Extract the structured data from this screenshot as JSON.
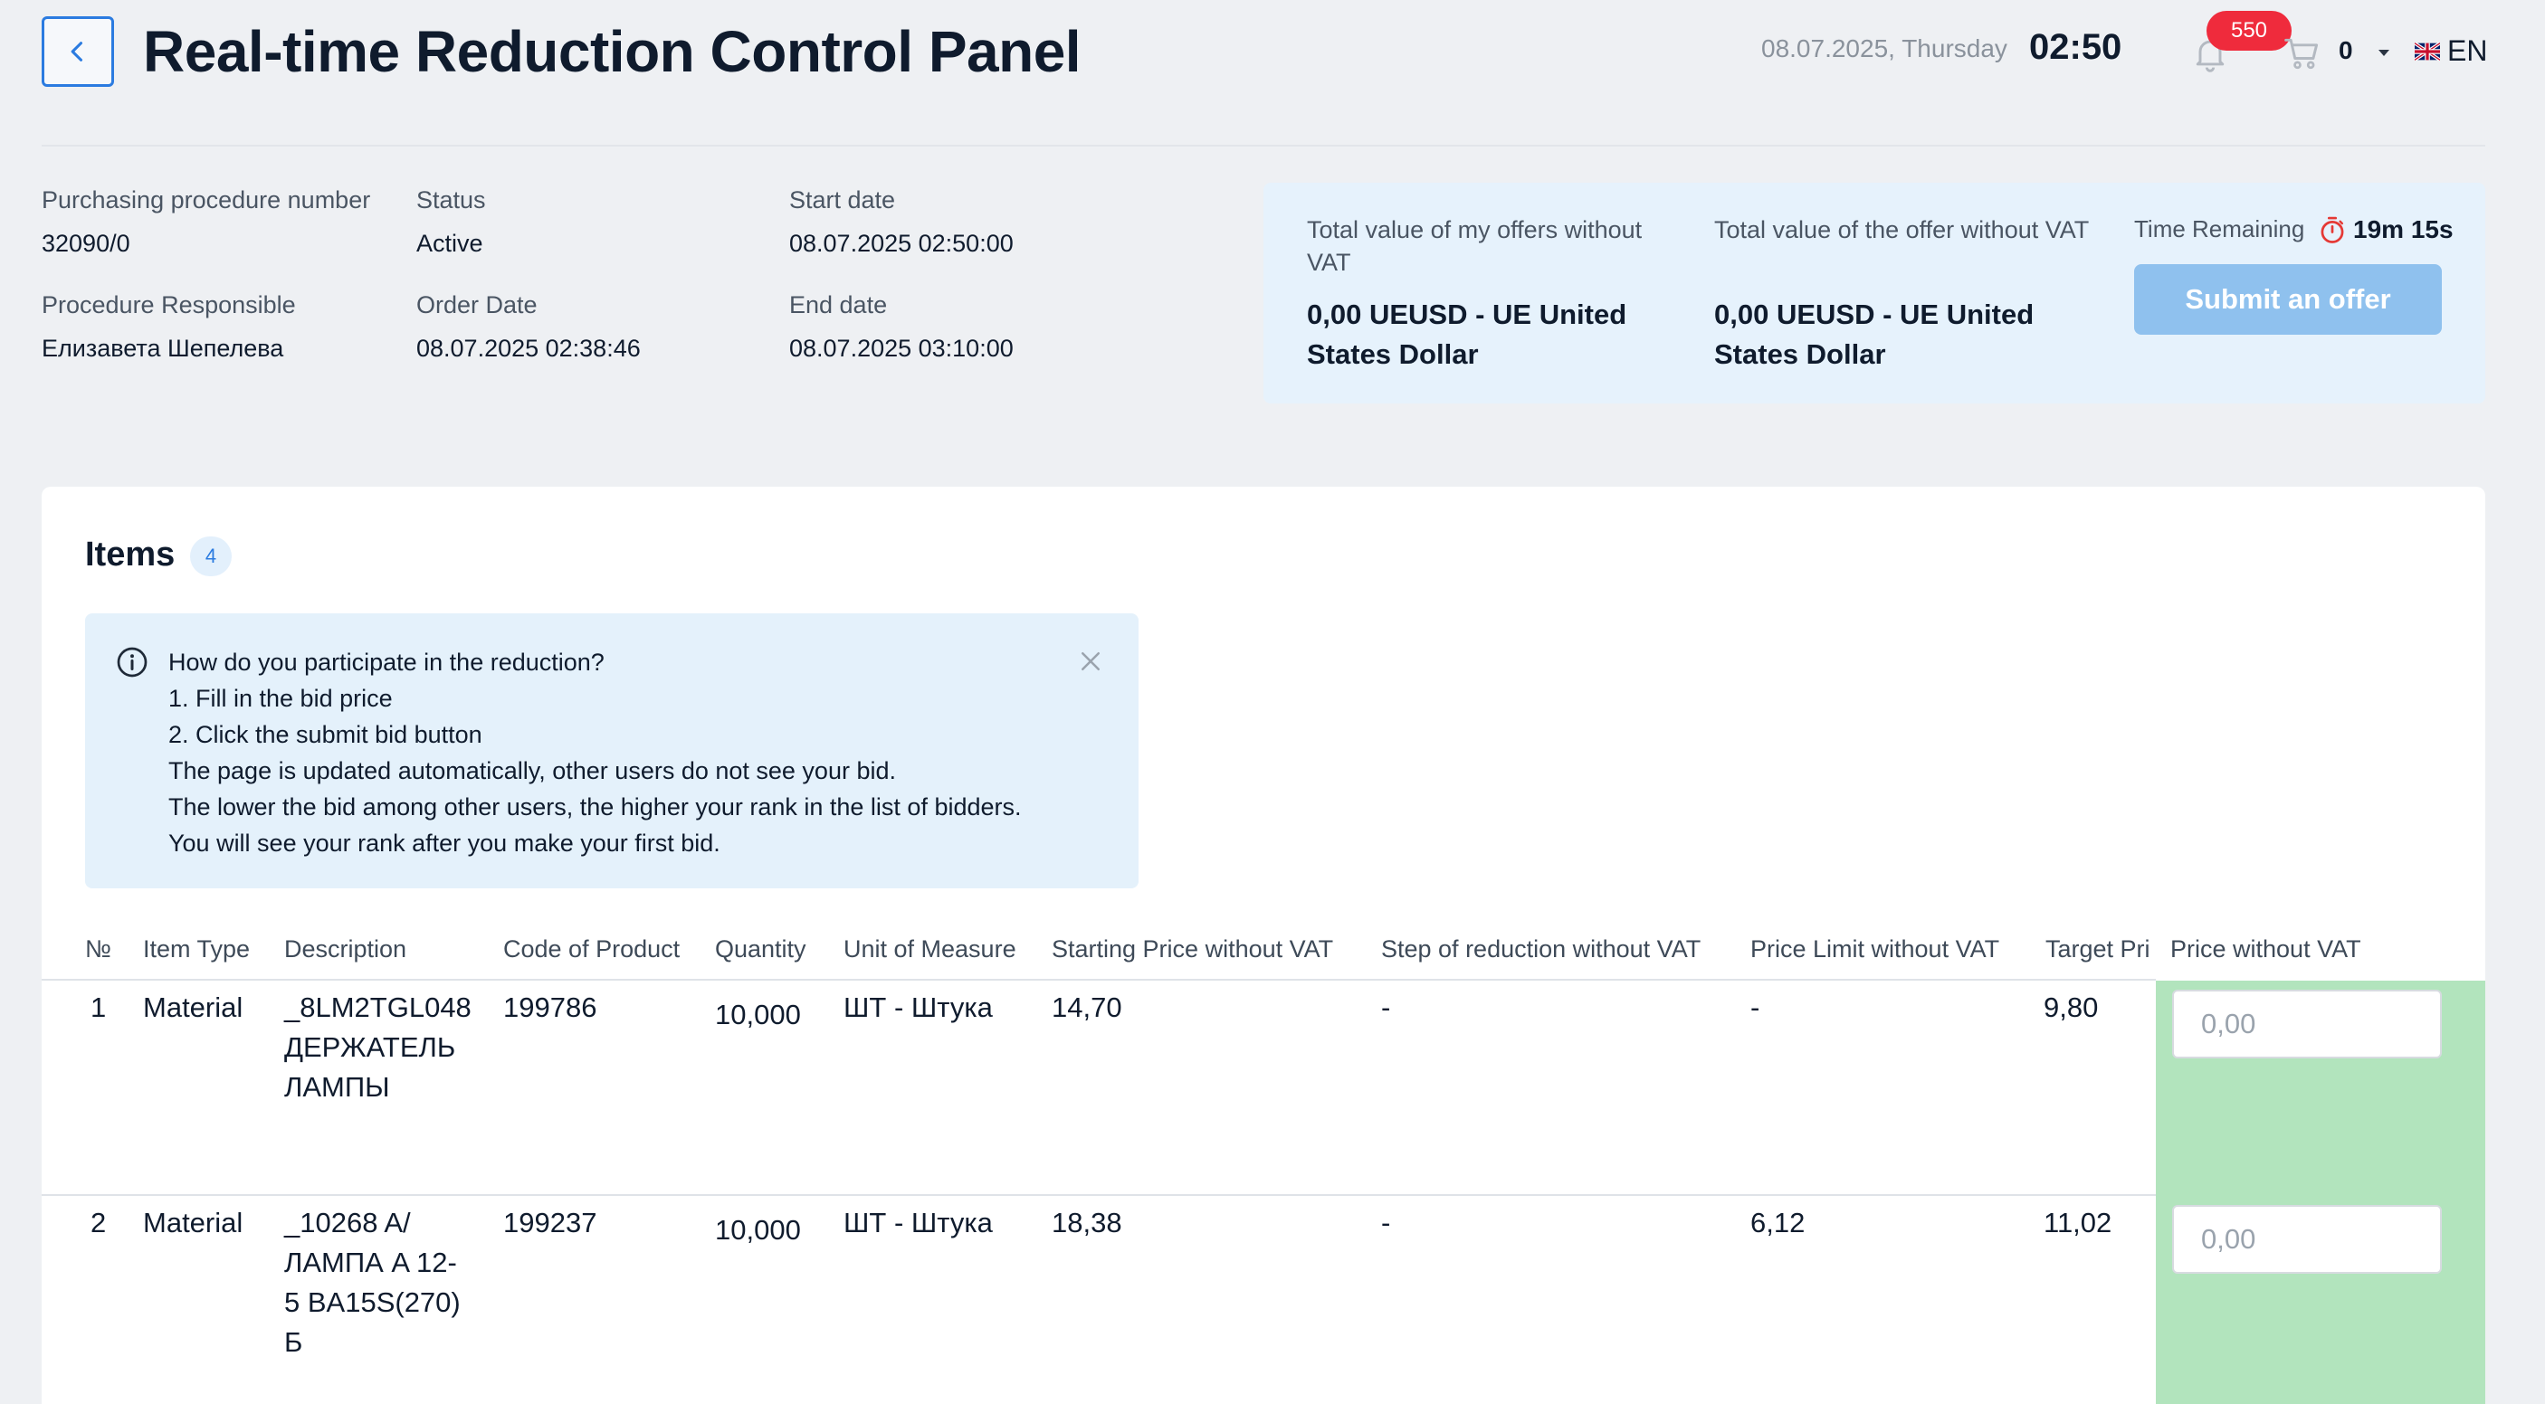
{
  "header": {
    "title": "Real-time Reduction Control Panel",
    "date": "08.07.2025, Thursday",
    "time": "02:50",
    "notification_count": "550",
    "cart_count": "0",
    "language": "EN",
    "icons": [
      "chevron-left-icon",
      "bell-icon",
      "cart-icon",
      "chevron-down-icon",
      "uk-flag-icon"
    ]
  },
  "procedure": {
    "number_label": "Purchasing procedure number",
    "number": "32090/0",
    "status_label": "Status",
    "status": "Active",
    "start_label": "Start date",
    "start": "08.07.2025 02:50:00",
    "responsible_label": "Procedure Responsible",
    "responsible": "Елизавета Шепелева",
    "order_label": "Order Date",
    "order": "08.07.2025 02:38:46",
    "end_label": "End date",
    "end": "08.07.2025 03:10:00"
  },
  "offer": {
    "my_total_label": "Total value of my offers without VAT",
    "my_total": "0,00 UEUSD - UE United States Dollar",
    "offer_total_label": "Total value of the offer without VAT",
    "offer_total": "0,00 UEUSD - UE United States Dollar",
    "time_remaining_label": "Time Remaining",
    "time_remaining": "19m 15s",
    "submit_label": "Submit an offer"
  },
  "items": {
    "title": "Items",
    "count": "4",
    "info_lines": [
      "How do you participate in the reduction?",
      "1. Fill in the bid price",
      "2. Click the submit bid button",
      "The page is updated automatically, other users do not see your bid.",
      "The lower the bid among other users, the higher your rank in the list of bidders.",
      "You will see your rank after you make your first bid."
    ],
    "columns": {
      "no": "№",
      "type": "Item Type",
      "description": "Description",
      "code": "Code of Product",
      "quantity": "Quantity",
      "unit": "Unit of Measure",
      "start_price": "Starting Price without VAT",
      "step": "Step of reduction without VAT",
      "limit": "Price Limit without VAT",
      "target": "Target Pri",
      "price": "Price without VAT"
    },
    "rows": [
      {
        "no": "1",
        "type": "Material",
        "desc_lines": [
          "_8LM2TGL048",
          "ДЕРЖАТЕЛЬ",
          "ЛАМПЫ"
        ],
        "code": "199786",
        "quantity": "10,000",
        "unit": "ШТ - Штука",
        "start_price": "14,70",
        "step": "-",
        "limit": "-",
        "target": "9,80",
        "price_placeholder": "0,00"
      },
      {
        "no": "2",
        "type": "Material",
        "desc_lines": [
          "_10268 A/",
          "ЛАМПА A 12-",
          "5 BA15S(270)",
          "Б"
        ],
        "code": "199237",
        "quantity": "10,000",
        "unit": "ШТ - Штука",
        "start_price": "18,38",
        "step": "-",
        "limit": "6,12",
        "target": "11,02",
        "price_placeholder": "0,00"
      }
    ]
  }
}
